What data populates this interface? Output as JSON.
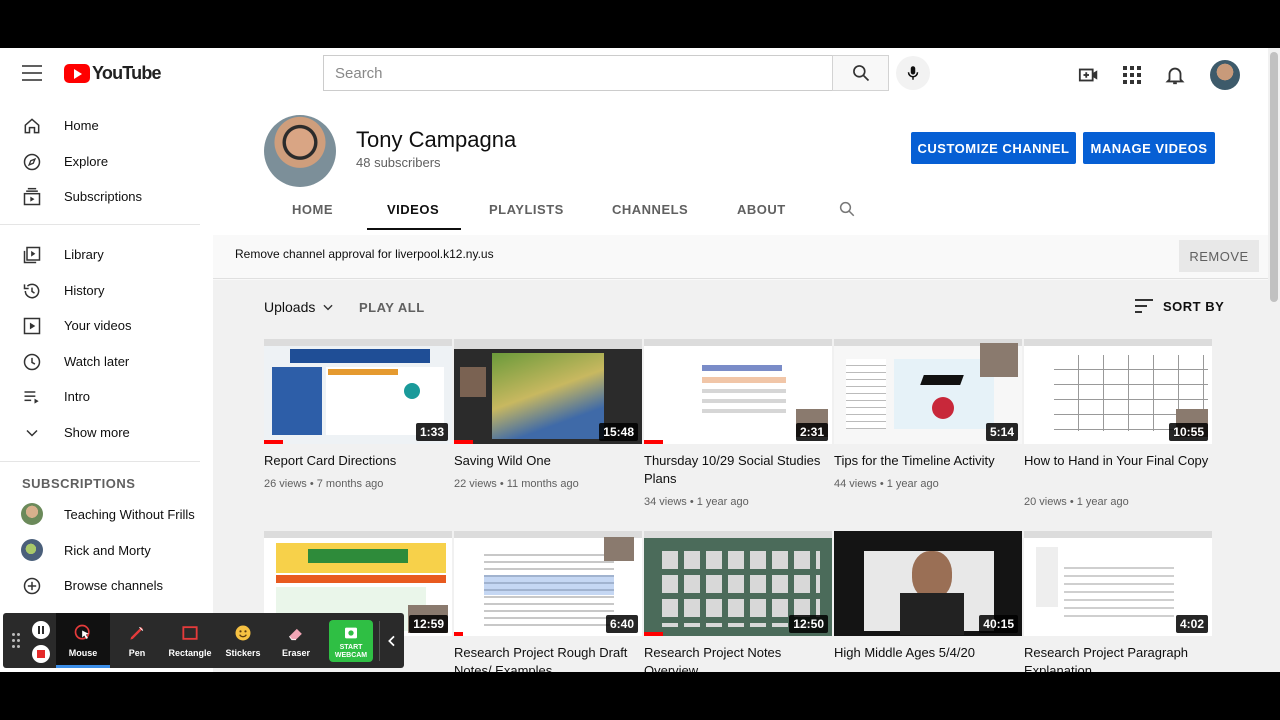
{
  "masthead": {
    "logo_text": "YouTube",
    "search_placeholder": "Search"
  },
  "sidebar": {
    "items": [
      {
        "label": "Home",
        "icon": "home-icon"
      },
      {
        "label": "Explore",
        "icon": "compass-icon"
      },
      {
        "label": "Subscriptions",
        "icon": "subscriptions-icon"
      },
      {
        "label": "Library",
        "icon": "library-icon"
      },
      {
        "label": "History",
        "icon": "history-icon"
      },
      {
        "label": "Your videos",
        "icon": "your-videos-icon"
      },
      {
        "label": "Watch later",
        "icon": "clock-icon"
      },
      {
        "label": "Intro",
        "icon": "playlist-icon"
      },
      {
        "label": "Show more",
        "icon": "chevron-down-icon"
      }
    ],
    "subscriptions_title": "SUBSCRIPTIONS",
    "subscriptions": [
      {
        "label": "Teaching Without Frills"
      },
      {
        "label": "Rick and Morty"
      },
      {
        "label": "Browse channels"
      }
    ]
  },
  "channel": {
    "name": "Tony Campagna",
    "subscribers": "48 subscribers",
    "customize_label": "CUSTOMIZE CHANNEL",
    "manage_label": "MANAGE VIDEOS",
    "tabs": [
      "HOME",
      "VIDEOS",
      "PLAYLISTS",
      "CHANNELS",
      "ABOUT"
    ],
    "active_tab": "VIDEOS"
  },
  "approval": {
    "text": "Remove channel approval for liverpool.k12.ny.us",
    "button": "REMOVE"
  },
  "videos": {
    "uploads_label": "Uploads",
    "play_all_label": "PLAY ALL",
    "sort_label": "SORT BY",
    "items": [
      {
        "title": "Report Card Directions",
        "duration": "1:33",
        "meta": "26 views • 7 months ago",
        "progress": 0.1
      },
      {
        "title": "Saving Wild One",
        "duration": "15:48",
        "meta": "22 views • 11 months ago",
        "progress": 0.1
      },
      {
        "title": "Thursday 10/29 Social Studies Plans",
        "duration": "2:31",
        "meta": "34 views • 1 year ago",
        "progress": 0.1
      },
      {
        "title": "Tips for the Timeline Activity",
        "duration": "5:14",
        "meta": "44 views • 1 year ago",
        "progress": 0
      },
      {
        "title": "How to Hand in Your Final Copy",
        "duration": "10:55",
        "meta": "20 views • 1 year ago",
        "progress": 0
      },
      {
        "title": "",
        "duration": "12:59",
        "meta": "",
        "progress": 0
      },
      {
        "title": "Research Project Rough Draft Notes/ Examples",
        "duration": "6:40",
        "meta": "",
        "progress": 0.05
      },
      {
        "title": "Research Project Notes Overview",
        "duration": "12:50",
        "meta": "",
        "progress": 0.1
      },
      {
        "title": "High Middle Ages 5/4/20",
        "duration": "40:15",
        "meta": "",
        "progress": 0
      },
      {
        "title": "Research Project Paragraph Explanation",
        "duration": "4:02",
        "meta": "",
        "progress": 0
      }
    ]
  },
  "toolbar": {
    "tools": [
      {
        "label": "Mouse",
        "icon": "mouse-cursor-icon"
      },
      {
        "label": "Pen",
        "icon": "pen-icon"
      },
      {
        "label": "Rectangle",
        "icon": "rectangle-icon"
      },
      {
        "label": "Stickers",
        "icon": "smiley-icon"
      },
      {
        "label": "Eraser",
        "icon": "eraser-icon"
      }
    ],
    "webcam_label_1": "START",
    "webcam_label_2": "WEBCAM"
  },
  "colors": {
    "youtube_red": "#ff0000",
    "button_blue": "#065fd4",
    "webcam_green": "#2fbf44"
  }
}
